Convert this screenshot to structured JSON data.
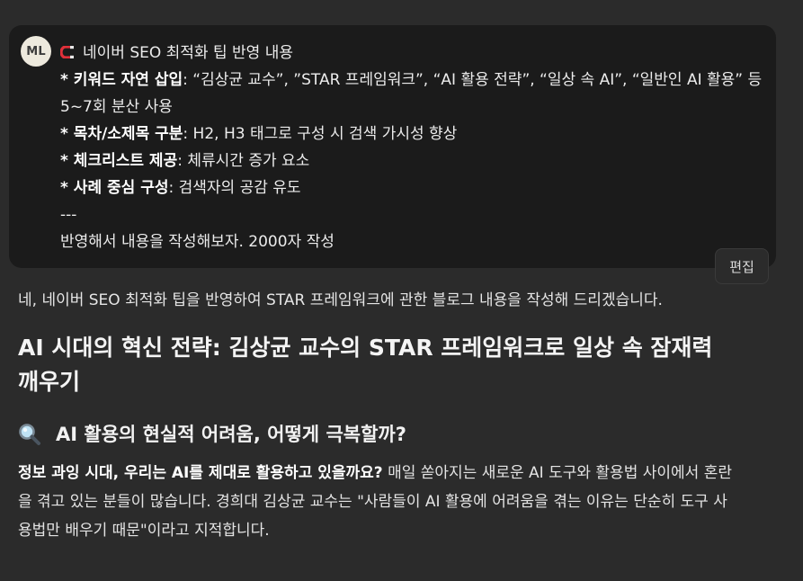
{
  "user": {
    "avatar_initials": "ML",
    "line1": "네이버 SEO 최적화 팁 반영 내용",
    "keyword_label": "* 키워드 자연 삽입",
    "keyword_text": ": “김상균 교수”, ”STAR 프레임워크”, “AI 활용 전략”, “일상 속 AI”, “일반인 AI 활용” 등 5~7회 분산 사용",
    "toc_label": "* 목차/소제목 구분",
    "toc_text": ": H2, H3 태그로 구성 시 검색 가시성 향상",
    "check_label": "* 체크리스트 제공",
    "check_text": ": 체류시간 증가 요소",
    "case_label": "* 사례 중심 구성",
    "case_text": ": 검색자의 공감 유도",
    "divider": "---",
    "request": "반영해서 내용을 작성해보자. 2000자 작성",
    "edit_label": "편집"
  },
  "answer": {
    "intro": "네, 네이버 SEO 최적화 팁을 반영하여 STAR 프레임워크에 관한 블로그 내용을 작성해 드리겠습니다.",
    "title": "AI 시대의 혁신 전략: 김상균 교수의 STAR 프레임워크로 일상 속 잠재력 깨우기",
    "section1_heading": "AI 활용의 현실적 어려움, 어떻게 극복할까?",
    "para1_bold": "정보 과잉 시대, 우리는 AI를 제대로 활용하고 있을까요?",
    "para1_text": " 매일 쏟아지는 새로운 AI 도구와 활용법 사이에서 혼란을 겪고 있는 분들이 많습니다. 경희대 김상균 교수는 \"사람들이 AI 활용에 어려움을 겪는 이유는 단순히 도구 사용법만 배우기 때문\"이라고 지적합니다."
  },
  "icons": {
    "magnet": "magnet-icon",
    "search": "search-icon"
  },
  "colors": {
    "background": "#2b2b2b",
    "user_card": "#1b1b1b",
    "magnet_red": "#e0303a"
  }
}
